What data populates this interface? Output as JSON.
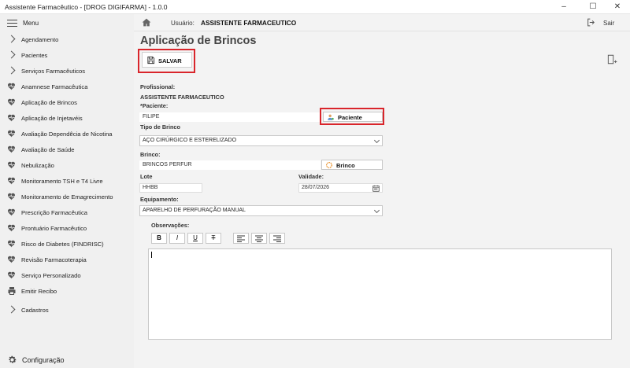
{
  "window": {
    "title": "Assistente Farmacêutico - [DROG DIGIFARMA] - 1.0.0",
    "controls": [
      "minimize-icon",
      "maximize-icon",
      "close-icon"
    ]
  },
  "sidebar": {
    "menu_label": "Menu",
    "items": [
      {
        "label": "Agendamento",
        "icon": "chevron-right-icon"
      },
      {
        "label": "Pacientes",
        "icon": "chevron-right-icon"
      },
      {
        "label": "Serviços Farmacêuticos",
        "icon": "chevron-right-icon"
      },
      {
        "label": "Anamnese Farmacêutica",
        "icon": "heart-icon"
      },
      {
        "label": "Aplicação de Brincos",
        "icon": "heart-icon"
      },
      {
        "label": "Aplicação de Injetavéis",
        "icon": "heart-icon"
      },
      {
        "label": "Avaliação Dependêcia de Nicotina",
        "icon": "heart-icon"
      },
      {
        "label": "Avaliação de Saúde",
        "icon": "heart-icon"
      },
      {
        "label": "Nebulização",
        "icon": "heart-icon"
      },
      {
        "label": "Monitoramento TSH e T4 Livre",
        "icon": "heart-icon"
      },
      {
        "label": "Monitoramento de Emagrecimento",
        "icon": "heart-icon"
      },
      {
        "label": "Prescrição Farmacêutica",
        "icon": "heart-icon"
      },
      {
        "label": "Prontuário Farmacêutico",
        "icon": "heart-icon"
      },
      {
        "label": "Risco de Diabetes (FINDRISC)",
        "icon": "heart-icon"
      },
      {
        "label": "Revisão Farmacoterapia",
        "icon": "heart-icon"
      },
      {
        "label": "Serviço Personalizado",
        "icon": "heart-icon"
      },
      {
        "label": "Emitir Recibo",
        "icon": "printer-icon"
      },
      {
        "label": "Cadastros",
        "icon": "chevron-right-icon"
      }
    ],
    "config_label": "Configuração"
  },
  "topbar": {
    "user_label": "Usuário:",
    "user_value": "ASSISTENTE FARMACEUTICO",
    "exit_label": "Sair"
  },
  "page": {
    "title": "Aplicação de Brincos",
    "save_label": "SALVAR"
  },
  "form": {
    "profissional_label": "Profissional:",
    "profissional_value": "ASSISTENTE FARMACEUTICO",
    "paciente_label": "*Paciente:",
    "paciente_value": "FILIPE",
    "paciente_button": "Paciente",
    "tipo_label": "Tipo de Brinco",
    "tipo_value": "AÇO CIRÚRGICO E ESTERELIZADO",
    "brinco_label": "Brinco:",
    "brinco_value": "BRINCOS PERFUR",
    "brinco_button": "Brinco",
    "lote_label": "Lote",
    "lote_value": "HHBB",
    "validade_label": "Validade:",
    "validade_value": "28/07/2026",
    "equipamento_label": "Equipamento:",
    "equipamento_value": "APARELHO DE PERFURAÇÃO MANUAL",
    "observacoes_label": "Observações:",
    "toolbar": {
      "bold": "B",
      "italic": "I",
      "underline": "U",
      "strike": "T"
    }
  },
  "colors": {
    "highlight": "#d9252b",
    "sidebar_bg": "#f0f0f0",
    "content_bg": "#f3f3f3"
  }
}
